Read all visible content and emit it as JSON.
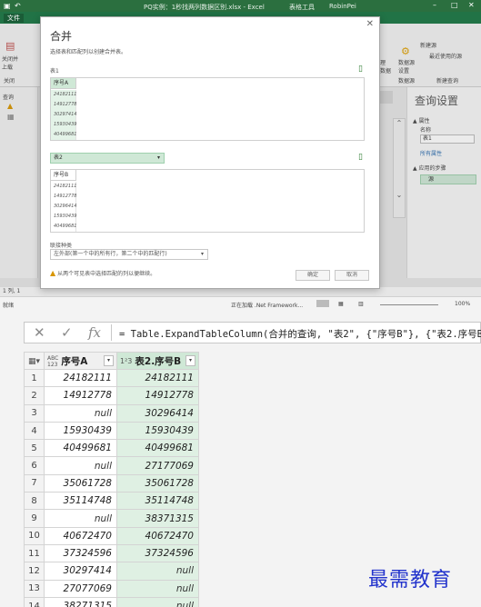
{
  "excel": {
    "window_title": "PQ实例：1秒找两列数据区别.xlsx - Excel",
    "context_tab": "表格工具",
    "user": "RobinPei",
    "file_tab": "文件",
    "ribbon": {
      "close_upload": "关闭并\n上载",
      "close_group": "关闭",
      "query_group": "查询",
      "manage_label": "理\n数据",
      "source_settings": "数据源\n设置",
      "data_source_group": "数据源",
      "new_source": "新建源",
      "recent_source": "最近使用的源",
      "new_query_group": "新建查询"
    },
    "query_settings": {
      "title": "查询设置",
      "properties": "▲ 属性",
      "name_label": "名称",
      "name_value": "表1",
      "all_properties": "所有属性",
      "applied_steps": "▲ 应用的步骤",
      "step_1": "源"
    },
    "status_bar": {
      "left": "就绪",
      "row_info": "1 列, 1",
      "loading": "正在加载 .Net Framework...",
      "zoom": "100%"
    }
  },
  "dialog": {
    "title": "合并",
    "description": "选择表和匹配列以创建合并表。",
    "table1_label": "表1",
    "table1_column": "序号A",
    "table1_values": [
      "24182111",
      "14912778",
      "30297414",
      "15930439",
      "40499681"
    ],
    "table2_selected": "表2",
    "table2_column": "序号B",
    "table2_values": [
      "24182111",
      "14912778",
      "30296414",
      "15930439",
      "40499681"
    ],
    "join_kind_label": "联接种类",
    "join_kind_value": "左外部(第一个中的所有行，第二个中的匹配行)",
    "warning": "从两个可见表中选择匹配的列以便继续。",
    "ok_label": "确定",
    "cancel_label": "取消"
  },
  "formula_bar": {
    "cancel_icon": "✕",
    "accept_icon": "✓",
    "fx": "fx",
    "formula": "= Table.ExpandTableColumn(合并的查询, \"表2\", {\"序号B\"}, {\"表2.序号B\""
  },
  "grid": {
    "col1_type": "ABC\n123",
    "col1_name": "序号A",
    "col2_type": "1²3",
    "col2_name": "表2.序号B",
    "rows": [
      {
        "n": "1",
        "a": "24182111",
        "b": "24182111"
      },
      {
        "n": "2",
        "a": "14912778",
        "b": "14912778"
      },
      {
        "n": "3",
        "a": "null",
        "b": "30296414"
      },
      {
        "n": "4",
        "a": "15930439",
        "b": "15930439"
      },
      {
        "n": "5",
        "a": "40499681",
        "b": "40499681"
      },
      {
        "n": "6",
        "a": "null",
        "b": "27177069"
      },
      {
        "n": "7",
        "a": "35061728",
        "b": "35061728"
      },
      {
        "n": "8",
        "a": "35114748",
        "b": "35114748"
      },
      {
        "n": "9",
        "a": "null",
        "b": "38371315"
      },
      {
        "n": "10",
        "a": "40672470",
        "b": "40672470"
      },
      {
        "n": "11",
        "a": "37324596",
        "b": "37324596"
      },
      {
        "n": "12",
        "a": "30297414",
        "b": "null"
      },
      {
        "n": "13",
        "a": "27077069",
        "b": "null"
      },
      {
        "n": "14",
        "a": "38271315",
        "b": "null"
      }
    ]
  },
  "watermark": "最需教育"
}
